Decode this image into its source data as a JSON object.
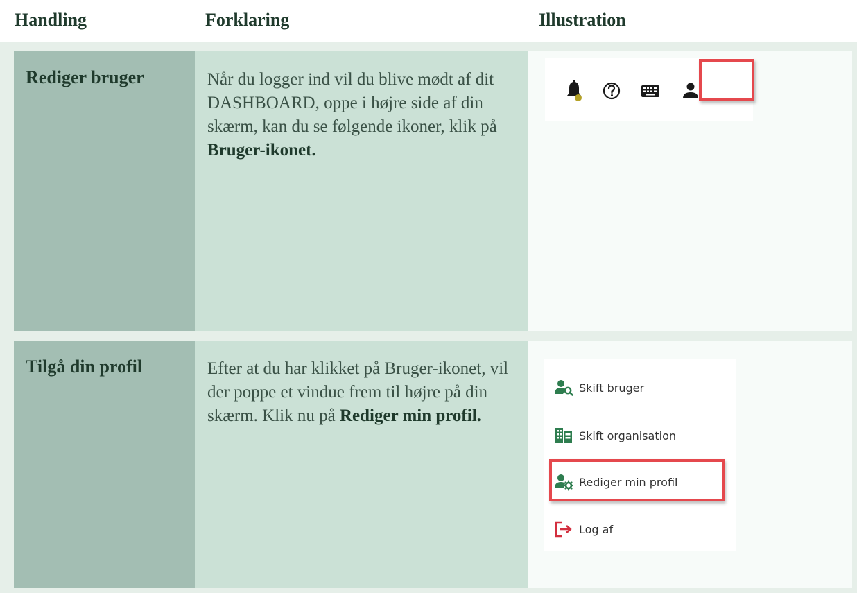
{
  "headers": {
    "action": "Handling",
    "explanation": "Forklaring",
    "illustration": "Illustration"
  },
  "rows": [
    {
      "action": "Rediger bruger",
      "text_before": "Når du logger ind vil du blive mødt af dit DASHBOARD, oppe i højre side af din skærm, kan du se følgende ikoner, klik på ",
      "text_bold": "Bruger-ikonet.",
      "illustration": {
        "icons": [
          "bell-icon",
          "help-icon",
          "keyboard-icon",
          "user-icon"
        ],
        "highlighted": "user-icon"
      }
    },
    {
      "action": "Tilgå din profil",
      "text_before": "Efter at du har klikket på Bruger-ikonet, vil der poppe et vindue frem til højre på din skærm. Klik nu på ",
      "text_bold": "Rediger min profil.",
      "illustration": {
        "menu_items": [
          {
            "label": "Skift bruger",
            "icon": "user-search-icon"
          },
          {
            "label": "Skift organisation",
            "icon": "organisation-icon"
          },
          {
            "label": "Rediger min profil",
            "icon": "user-settings-icon"
          },
          {
            "label": "Log af",
            "icon": "logout-icon"
          }
        ],
        "highlighted": "Rediger min profil"
      }
    }
  ],
  "colors": {
    "heading": "#1f3a2c",
    "action_cell": "#a3beb3",
    "explanation_cell": "#cbe1d6",
    "illustration_cell": "#f7fbf9",
    "table_bg": "#e6efe9",
    "highlight": "#e5484d",
    "menu_icon_green": "#2e7d4f",
    "logout_red": "#d32f3f"
  }
}
